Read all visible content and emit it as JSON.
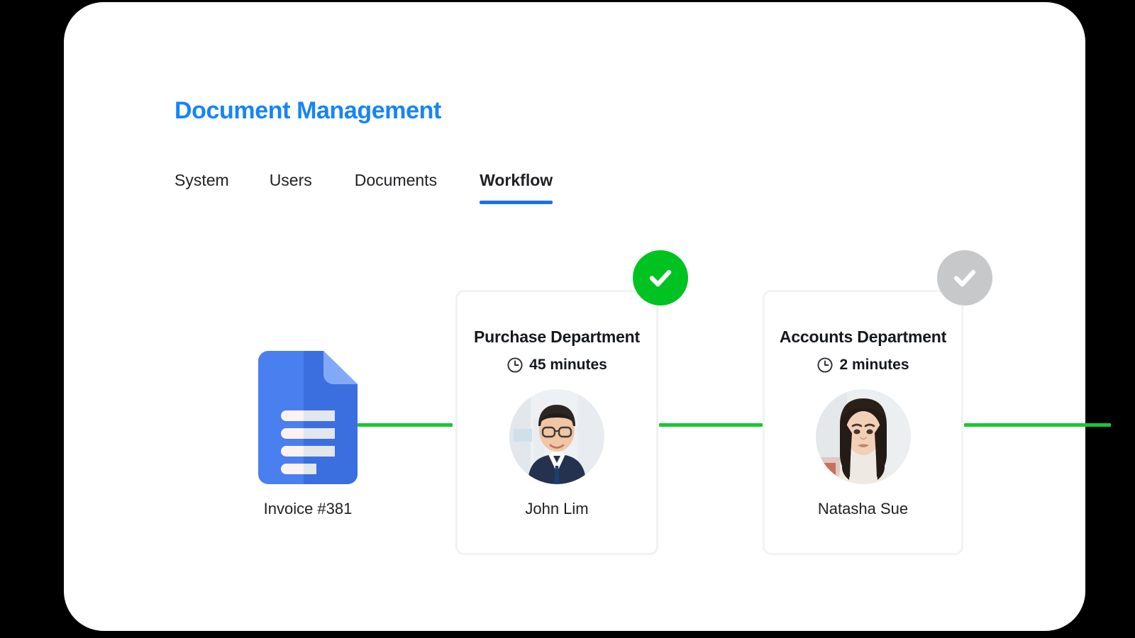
{
  "app": {
    "title": "Document Management",
    "title_color": "#1585f5",
    "panel_background": "#ffffff",
    "page_background": "#000000"
  },
  "tabs": {
    "active_index": 3,
    "active_underline_color": "#1a73e8",
    "items": [
      {
        "label": "System",
        "active": false
      },
      {
        "label": "Users",
        "active": false
      },
      {
        "label": "Documents",
        "active": false
      },
      {
        "label": "Workflow",
        "active": true
      }
    ]
  },
  "workflow": {
    "connector_color": "#16c932",
    "document": {
      "icon": "document-icon",
      "caption": "Invoice #381",
      "icon_color_primary": "#4a7ff0",
      "icon_color_secondary": "#82a9f8"
    },
    "steps": [
      {
        "title": "Purchase Department",
        "duration_icon": "clock-icon",
        "duration": "45 minutes",
        "assignee_name": "John Lim",
        "assignee_avatar": "avatar-john-lim",
        "status": "complete",
        "status_icon": "check-circle-icon",
        "status_color": "#00c322"
      },
      {
        "title": "Accounts Department",
        "duration_icon": "clock-icon",
        "duration": "2 minutes",
        "assignee_name": "Natasha Sue",
        "assignee_avatar": "avatar-natasha-sue",
        "status": "pending",
        "status_icon": "check-circle-icon",
        "status_color": "#c6c8ca"
      }
    ]
  }
}
